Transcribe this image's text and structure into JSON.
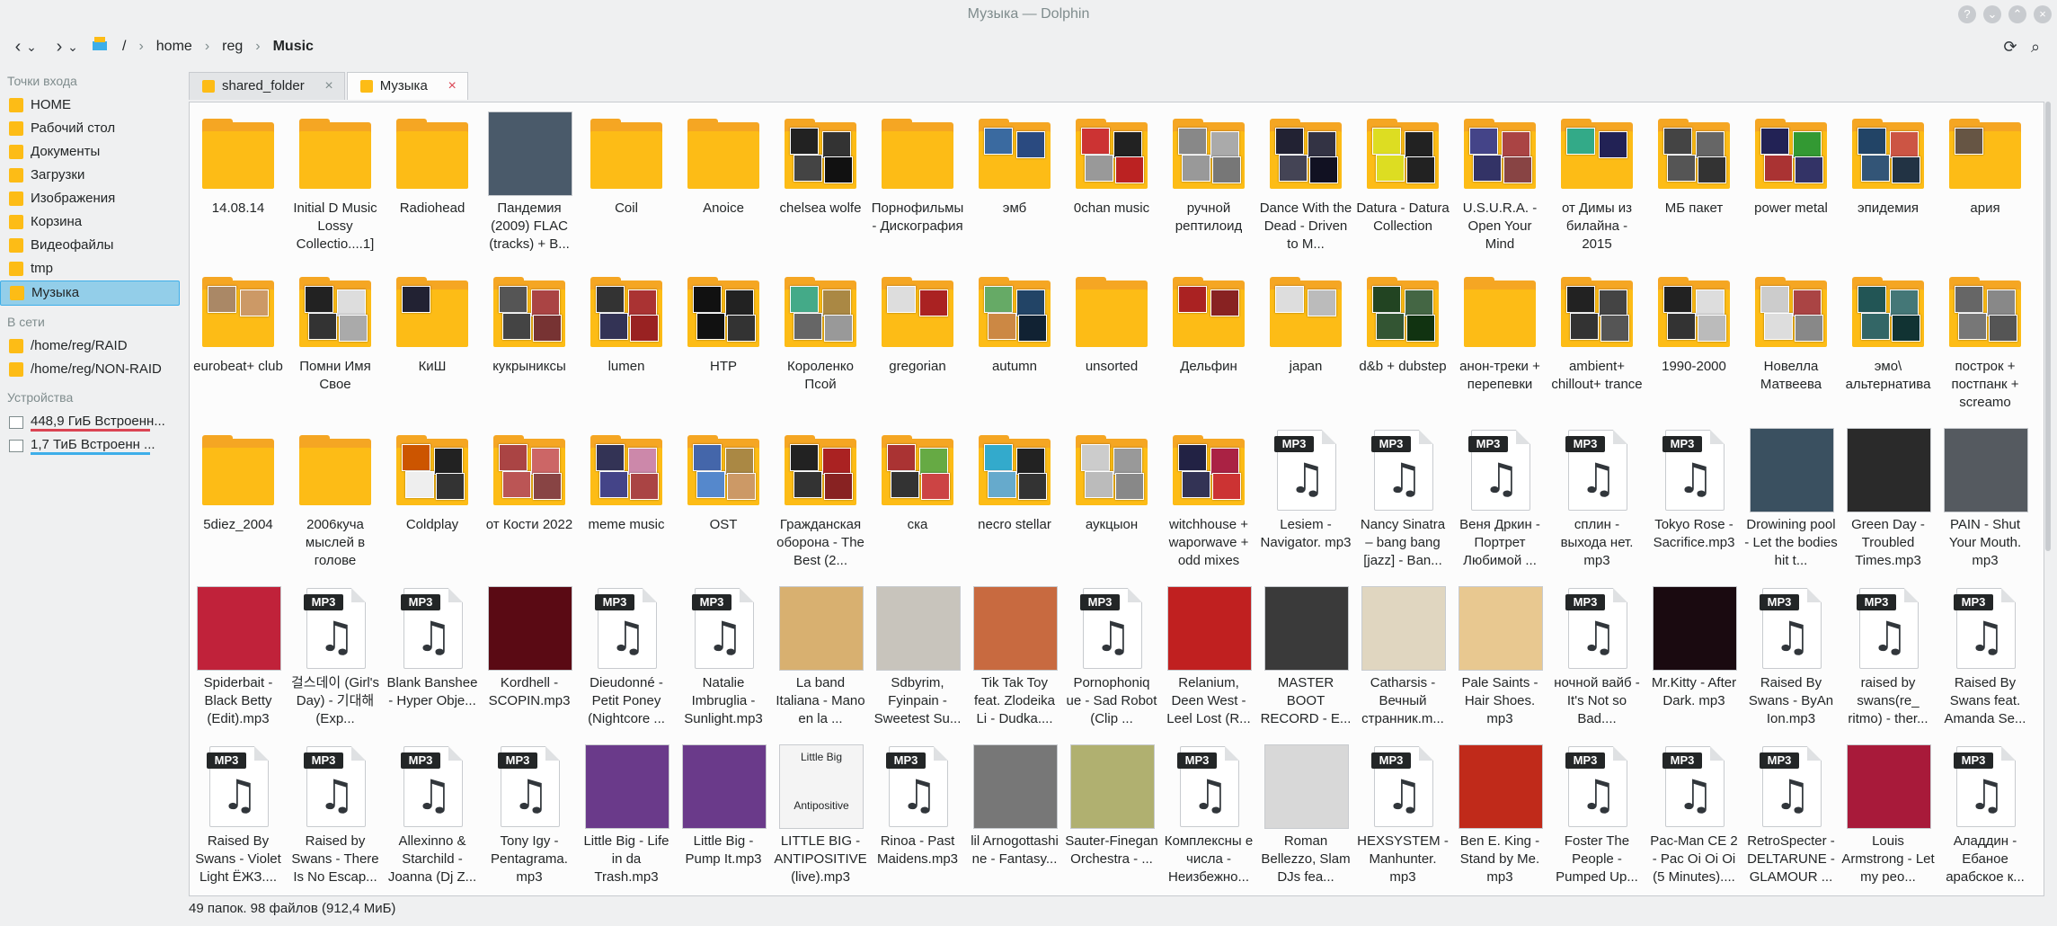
{
  "window": {
    "title": "Музыка — Dolphin"
  },
  "toolbar": {
    "back": "‹",
    "back_menu": "⌄",
    "forward": "›",
    "forward_menu": "⌄"
  },
  "breadcrumb": [
    "/",
    "home",
    "reg",
    "Music"
  ],
  "sidebar": {
    "places_header": "Точки входа",
    "places": [
      "HOME",
      "Рабочий стол",
      "Документы",
      "Загрузки",
      "Изображения",
      "Корзина",
      "Видеофайлы",
      "tmp",
      "Музыка"
    ],
    "network_header": "В сети",
    "network": [
      "/home/reg/RAID",
      "/home/reg/NON-RAID"
    ],
    "devices_header": "Устройства",
    "devices": [
      {
        "label": "448,9 ГиБ Встроенн...",
        "bar_color": "#da4453",
        "fill": 0.95
      },
      {
        "label": "1,7 ТиБ Встроенн ...",
        "bar_color": "#3daee9",
        "fill": 0.95
      }
    ]
  },
  "tabs": [
    {
      "label": "shared_folder",
      "active": false
    },
    {
      "label": "Музыка",
      "active": true
    }
  ],
  "items": [
    {
      "type": "folder",
      "name": "14.08.14",
      "thumbs": []
    },
    {
      "type": "folder",
      "name": "Initial D Music Lossy Collectio....1]",
      "thumbs": []
    },
    {
      "type": "folder",
      "name": "Radiohead",
      "thumbs": []
    },
    {
      "type": "cover",
      "name": "Пандемия (2009) FLAC (tracks) + B...",
      "color": "#4a5a6a"
    },
    {
      "type": "folder",
      "name": "Coil",
      "thumbs": []
    },
    {
      "type": "folder",
      "name": "Anoice",
      "thumbs": []
    },
    {
      "type": "folder",
      "name": "chelsea wolfe",
      "thumbs": [
        "#222",
        "#333",
        "#444",
        "#111"
      ]
    },
    {
      "type": "folder",
      "name": "Порнофильмы - Дискография",
      "thumbs": []
    },
    {
      "type": "folder",
      "name": "эмб",
      "thumbs": [
        "#3a6aa0",
        "#2a4a80"
      ]
    },
    {
      "type": "folder",
      "name": "0chan music",
      "thumbs": [
        "#c33",
        "#222",
        "#999",
        "#b22"
      ]
    },
    {
      "type": "folder",
      "name": "ручной рептилоид",
      "thumbs": [
        "#888",
        "#aaa",
        "#999",
        "#777"
      ]
    },
    {
      "type": "folder",
      "name": "Dance With the Dead - Driven to M...",
      "thumbs": [
        "#223",
        "#334",
        "#445",
        "#112"
      ]
    },
    {
      "type": "folder",
      "name": "Datura - Datura Collection",
      "thumbs": [
        "#dd2",
        "#222",
        "#dd2",
        "#222"
      ]
    },
    {
      "type": "folder",
      "name": "U.S.U.R.A. - Open Your Mind",
      "thumbs": [
        "#448",
        "#a44",
        "#336",
        "#844"
      ]
    },
    {
      "type": "folder",
      "name": "от Димы из билайна - 2015",
      "thumbs": [
        "#3a8",
        "#225"
      ]
    },
    {
      "type": "folder",
      "name": "МБ пакет",
      "thumbs": [
        "#444",
        "#666",
        "#555",
        "#333"
      ]
    },
    {
      "type": "folder",
      "name": "power metal",
      "thumbs": [
        "#225",
        "#393",
        "#a33",
        "#336"
      ]
    },
    {
      "type": "folder",
      "name": "эпидемия",
      "thumbs": [
        "#246",
        "#c54",
        "#357",
        "#234"
      ]
    },
    {
      "type": "folder",
      "name": "ария",
      "thumbs": [
        "#654"
      ]
    },
    {
      "type": "folder",
      "name": "eurobeat+ club",
      "thumbs": [
        "#a86",
        "#c96"
      ]
    },
    {
      "type": "folder",
      "name": "Помни Имя Свое",
      "thumbs": [
        "#222",
        "#ddd",
        "#333",
        "#aaa"
      ]
    },
    {
      "type": "folder",
      "name": "КиШ",
      "thumbs": [
        "#223"
      ]
    },
    {
      "type": "folder",
      "name": "кукрыниксы",
      "thumbs": [
        "#555",
        "#a44",
        "#444",
        "#733"
      ]
    },
    {
      "type": "folder",
      "name": "lumen",
      "thumbs": [
        "#333",
        "#a33",
        "#335",
        "#922"
      ]
    },
    {
      "type": "folder",
      "name": "НТР",
      "thumbs": [
        "#111",
        "#222",
        "#111",
        "#333"
      ]
    },
    {
      "type": "folder",
      "name": "Короленко Псой",
      "thumbs": [
        "#4a8",
        "#a84",
        "#666",
        "#999"
      ]
    },
    {
      "type": "folder",
      "name": "gregorian",
      "thumbs": [
        "#ddd",
        "#a22"
      ]
    },
    {
      "type": "folder",
      "name": "autumn",
      "thumbs": [
        "#6a6",
        "#246",
        "#c84",
        "#123"
      ]
    },
    {
      "type": "folder",
      "name": "unsorted",
      "thumbs": []
    },
    {
      "type": "folder",
      "name": "Дельфин",
      "thumbs": [
        "#a22",
        "#822"
      ]
    },
    {
      "type": "folder",
      "name": "japan",
      "thumbs": [
        "#ddd",
        "#bbb"
      ]
    },
    {
      "type": "folder",
      "name": "d&b + dubstep",
      "thumbs": [
        "#242",
        "#464",
        "#353",
        "#131"
      ]
    },
    {
      "type": "folder",
      "name": "анон-треки + перепевки",
      "thumbs": []
    },
    {
      "type": "folder",
      "name": "ambient+ chillout+ trance",
      "thumbs": [
        "#222",
        "#444",
        "#333",
        "#555"
      ]
    },
    {
      "type": "folder",
      "name": "1990-2000",
      "thumbs": [
        "#222",
        "#ddd",
        "#333",
        "#bbb"
      ]
    },
    {
      "type": "folder",
      "name": "Новелла Матвеева",
      "thumbs": [
        "#ccc",
        "#a44",
        "#ddd",
        "#888"
      ]
    },
    {
      "type": "folder",
      "name": "эмо\\ альтернатива",
      "thumbs": [
        "#255",
        "#477",
        "#366",
        "#133"
      ]
    },
    {
      "type": "folder",
      "name": "построк + постпанк + screamo",
      "thumbs": [
        "#666",
        "#888",
        "#777",
        "#555"
      ]
    },
    {
      "type": "folder",
      "name": "5diez_2004",
      "thumbs": []
    },
    {
      "type": "folder",
      "name": "2006куча мыслей в голове",
      "thumbs": []
    },
    {
      "type": "folder",
      "name": "Coldplay",
      "thumbs": [
        "#c50",
        "#222",
        "#eee",
        "#333"
      ]
    },
    {
      "type": "folder",
      "name": "от Кости 2022",
      "thumbs": [
        "#a44",
        "#c66",
        "#b55",
        "#844"
      ]
    },
    {
      "type": "folder",
      "name": "meme music",
      "thumbs": [
        "#335",
        "#c8a",
        "#448",
        "#a44"
      ]
    },
    {
      "type": "folder",
      "name": "OST",
      "thumbs": [
        "#46a",
        "#a84",
        "#58c",
        "#c96"
      ]
    },
    {
      "type": "folder",
      "name": "Гражданская оборона - The Best (2...",
      "thumbs": [
        "#222",
        "#a22",
        "#333",
        "#822"
      ]
    },
    {
      "type": "folder",
      "name": "ска",
      "thumbs": [
        "#a33",
        "#6a4",
        "#333",
        "#c44"
      ]
    },
    {
      "type": "folder",
      "name": "necro stellar",
      "thumbs": [
        "#3ac",
        "#222",
        "#6ac",
        "#333"
      ]
    },
    {
      "type": "folder",
      "name": "аукцыон",
      "thumbs": [
        "#ccc",
        "#999",
        "#bbb",
        "#888"
      ]
    },
    {
      "type": "folder",
      "name": "witchhouse + waporwave + odd mixes",
      "thumbs": [
        "#224",
        "#a24",
        "#335",
        "#c33"
      ]
    },
    {
      "type": "mp3",
      "name": "Lesiem - Navigator. mp3"
    },
    {
      "type": "mp3",
      "name": "Nancy Sinatra – bang bang [jazz] - Ban..."
    },
    {
      "type": "mp3",
      "name": "Веня Дркин - Портрет Любимой ..."
    },
    {
      "type": "mp3",
      "name": "сплин - выхода нет. mp3"
    },
    {
      "type": "mp3",
      "name": "Tokyo Rose - Sacrifice.mp3"
    },
    {
      "type": "cover",
      "name": "Drowining pool - Let the bodies hit t...",
      "color": "#3a5060"
    },
    {
      "type": "cover",
      "name": "Green Day - Troubled Times.mp3",
      "color": "#2a2a2a"
    },
    {
      "type": "cover",
      "name": "PAIN - Shut Your Mouth. mp3",
      "color": "#555a60"
    },
    {
      "type": "cover",
      "name": "Spiderbait - Black Betty (Edit).mp3",
      "color": "#c0223a"
    },
    {
      "type": "mp3",
      "name": "걸스데이 (Girl's Day) - 기대해 (Exp..."
    },
    {
      "type": "mp3",
      "name": "Blank Banshee - Hyper Obje..."
    },
    {
      "type": "cover",
      "name": "Kordhell - SCOPIN.mp3",
      "color": "#5a0a14"
    },
    {
      "type": "mp3",
      "name": "Dieudonné - Petit Poney (Nightcore ..."
    },
    {
      "type": "mp3",
      "name": "Natalie Imbruglia - Sunlight.mp3"
    },
    {
      "type": "cover",
      "name": "La band Italiana - Mano en la ...",
      "color": "#d8b070"
    },
    {
      "type": "cover",
      "name": "Sdbyrim, Fyinpain - Sweetest Su...",
      "color": "#c8c4bc"
    },
    {
      "type": "cover",
      "name": "Tik Tak Toy feat. Zlodeika Li - Dudka....",
      "color": "#c86a40"
    },
    {
      "type": "mp3",
      "name": "Pornophoniq ue - Sad Robot (Clip ..."
    },
    {
      "type": "cover",
      "name": "Relanium, Deen West - Leel Lost (R...",
      "color": "#c02020"
    },
    {
      "type": "cover",
      "name": "MASTER BOOT RECORD - E...",
      "color": "#3a3a3a"
    },
    {
      "type": "cover",
      "name": "Catharsis - Вечный странник.m...",
      "color": "#e0d6c0"
    },
    {
      "type": "cover",
      "name": "Pale Saints - Hair Shoes. mp3",
      "color": "#e8c890"
    },
    {
      "type": "mp3",
      "name": "⁣ночной вайб⁣ - It's Not so Bad...."
    },
    {
      "type": "cover",
      "name": "Mr.Kitty - After Dark. mp3",
      "color": "#1a0a10"
    },
    {
      "type": "mp3",
      "name": "Raised By Swans - ByAn Ion.mp3"
    },
    {
      "type": "mp3",
      "name": "raised by swans(re_ ritmo) - ther..."
    },
    {
      "type": "mp3",
      "name": "Raised By Swans feat. Amanda Se..."
    },
    {
      "type": "mp3",
      "name": "Raised By Swans - Violet Light ЁЖЗ...."
    },
    {
      "type": "mp3",
      "name": "Raised by Swans - There Is No Escap..."
    },
    {
      "type": "mp3",
      "name": "Allexinno & Starchild - Joanna (Dj Z..."
    },
    {
      "type": "mp3",
      "name": "Tony Igy - Pentagrama. mp3"
    },
    {
      "type": "cover",
      "name": "Little Big - Life in da Trash.mp3",
      "color": "#6a3a8a"
    },
    {
      "type": "cover",
      "name": "Little Big - Pump It.mp3",
      "color": "#6a3a8a"
    },
    {
      "type": "cover",
      "name": "LITTLE BIG - ANTIPOSITIVE (live).mp3",
      "color": "#f4f4f4",
      "cover_text": [
        "Little Big",
        "Antipositive"
      ]
    },
    {
      "type": "mp3",
      "name": "Rinoa - Past Maidens.mp3"
    },
    {
      "type": "cover",
      "name": "lil Arnogottashi ne - Fantasy...",
      "color": "#777"
    },
    {
      "type": "cover",
      "name": "Sauter-Finegan Orchestra - ...",
      "color": "#b0b070"
    },
    {
      "type": "mp3",
      "name": "Комплексны е числа - Неизбежно..."
    },
    {
      "type": "cover",
      "name": "Roman Bellezzo, Slam DJs fea...",
      "color": "#d8d8d8"
    },
    {
      "type": "mp3",
      "name": "HEXSYSTEM - Manhunter. mp3"
    },
    {
      "type": "cover",
      "name": "Ben E. King - Stand by Me. mp3",
      "color": "#c02a1a"
    },
    {
      "type": "mp3",
      "name": "Foster The People - Pumped Up..."
    },
    {
      "type": "mp3",
      "name": "Pac-Man CE 2 - Pac Oi Oi Oi (5 Minutes)...."
    },
    {
      "type": "mp3",
      "name": "RetroSpecter - DELTARUNE - GLAMOUR ..."
    },
    {
      "type": "cover",
      "name": "Louis Armstrong - Let my peo...",
      "color": "#a81a3a"
    },
    {
      "type": "mp3",
      "name": "Аладдин - Ебаное арабское к..."
    }
  ],
  "mp3_badge": "MP3",
  "note_glyph": "♫",
  "status": "49 папок. 98 файлов (912,4 МиБ)"
}
